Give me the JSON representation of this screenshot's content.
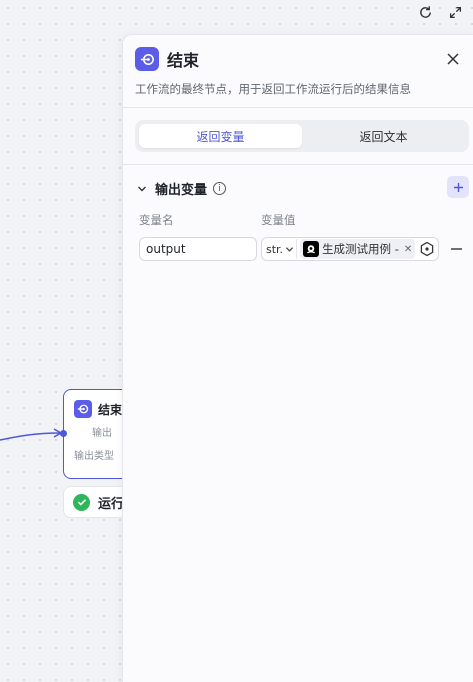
{
  "node": {
    "title": "结束",
    "output_label": "输出",
    "output_type_label": "输出类型"
  },
  "run_status": {
    "text": "运行"
  },
  "panel": {
    "title": "结束",
    "description": "工作流的最终节点，用于返回工作流运行后的结果信息",
    "tabs": [
      {
        "label": "返回变量",
        "active": true
      },
      {
        "label": "返回文本",
        "active": false
      }
    ],
    "section": {
      "title": "输出变量",
      "info_icon": "info-icon",
      "add_icon": "plus-icon"
    },
    "columns": {
      "name": "变量名",
      "value": "变量值"
    },
    "variables": [
      {
        "name": "output",
        "type": "str.",
        "reference": "生成测试用例 -",
        "reference_icon": "llm-logo-icon"
      }
    ]
  },
  "colors": {
    "accent": "#4e57d6",
    "success": "#2fb55a",
    "node_icon": "#5b5de8"
  }
}
